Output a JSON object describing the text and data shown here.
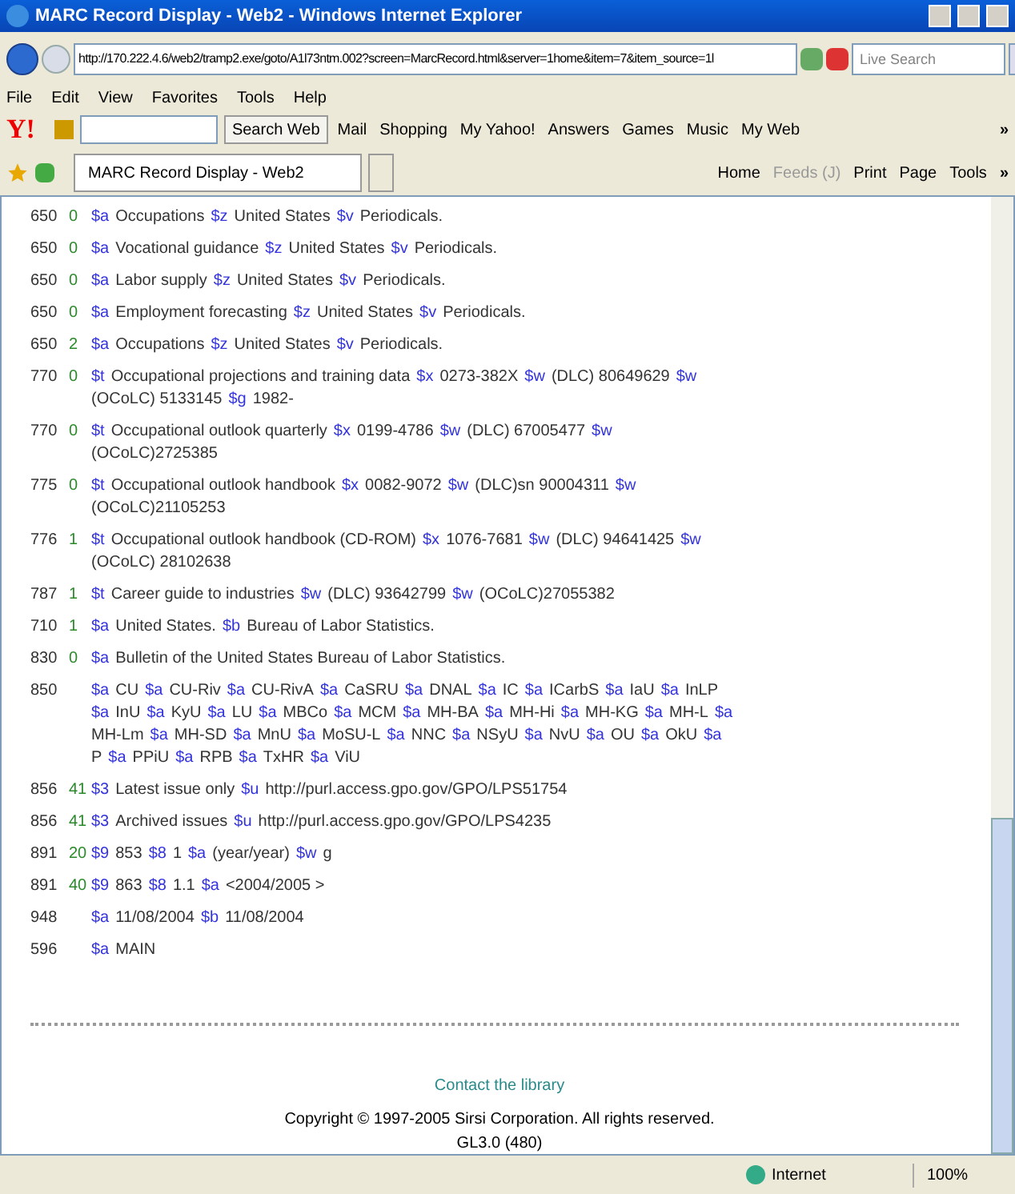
{
  "window": {
    "title": "MARC Record Display - Web2 - Windows Internet Explorer"
  },
  "address_bar": {
    "url": "http://170.222.4.6/web2/tramp2.exe/goto/A1l73ntm.002?screen=MarcRecord.html&server=1home&item=7&item_source=1l",
    "search_placeholder": "Live Search"
  },
  "menu": [
    "File",
    "Edit",
    "View",
    "Favorites",
    "Tools",
    "Help"
  ],
  "yahoo_toolbar": {
    "logo": "Y!",
    "search_button": "Search Web",
    "items": [
      "Mail",
      "Shopping",
      "My Yahoo!",
      "Answers",
      "Games",
      "Music",
      "My Web"
    ],
    "more": "»"
  },
  "tab": {
    "label": "MARC Record Display - Web2",
    "selected": true
  },
  "command_bar": [
    {
      "label": "Home",
      "disabled": false
    },
    {
      "label": "Feeds (J)",
      "disabled": true
    },
    {
      "label": "Print",
      "disabled": false
    },
    {
      "label": "Page",
      "disabled": false
    },
    {
      "label": "Tools",
      "disabled": false
    }
  ],
  "command_more": "»",
  "records": [
    {
      "tag": "650",
      "ind": "0",
      "subfields": [
        {
          "code": "$a",
          "text": "Occupations"
        },
        {
          "code": "$z",
          "text": "United States"
        },
        {
          "code": "$v",
          "text": "Periodicals."
        }
      ]
    },
    {
      "tag": "650",
      "ind": "0",
      "subfields": [
        {
          "code": "$a",
          "text": "Vocational guidance"
        },
        {
          "code": "$z",
          "text": "United States"
        },
        {
          "code": "$v",
          "text": "Periodicals."
        }
      ]
    },
    {
      "tag": "650",
      "ind": "0",
      "subfields": [
        {
          "code": "$a",
          "text": "Labor supply"
        },
        {
          "code": "$z",
          "text": "United States"
        },
        {
          "code": "$v",
          "text": "Periodicals."
        }
      ]
    },
    {
      "tag": "650",
      "ind": "0",
      "subfields": [
        {
          "code": "$a",
          "text": "Employment forecasting"
        },
        {
          "code": "$z",
          "text": "United States"
        },
        {
          "code": "$v",
          "text": "Periodicals."
        }
      ]
    },
    {
      "tag": "650",
      "ind": "2",
      "subfields": [
        {
          "code": "$a",
          "text": "Occupations"
        },
        {
          "code": "$z",
          "text": "United States"
        },
        {
          "code": "$v",
          "text": "Periodicals."
        }
      ]
    },
    {
      "tag": "770",
      "ind": "0",
      "subfields": [
        {
          "code": "$t",
          "text": "Occupational projections and training data"
        },
        {
          "code": "$x",
          "text": "0273-382X"
        },
        {
          "code": "$w",
          "text": "(DLC) 80649629"
        },
        {
          "code": "$w",
          "text": "(OCoLC) 5133145"
        },
        {
          "code": "$g",
          "text": "1982-"
        }
      ]
    },
    {
      "tag": "770",
      "ind": "0",
      "subfields": [
        {
          "code": "$t",
          "text": "Occupational outlook quarterly"
        },
        {
          "code": "$x",
          "text": "0199-4786"
        },
        {
          "code": "$w",
          "text": "(DLC) 67005477"
        },
        {
          "code": "$w",
          "text": "(OCoLC)2725385"
        }
      ]
    },
    {
      "tag": "775",
      "ind": "0",
      "subfields": [
        {
          "code": "$t",
          "text": "Occupational outlook handbook"
        },
        {
          "code": "$x",
          "text": "0082-9072"
        },
        {
          "code": "$w",
          "text": "(DLC)sn 90004311"
        },
        {
          "code": "$w",
          "text": "(OCoLC)21105253"
        }
      ]
    },
    {
      "tag": "776",
      "ind": "1",
      "subfields": [
        {
          "code": "$t",
          "text": "Occupational outlook handbook (CD-ROM)"
        },
        {
          "code": "$x",
          "text": "1076-7681"
        },
        {
          "code": "$w",
          "text": "(DLC) 94641425"
        },
        {
          "code": "$w",
          "text": "(OCoLC) 28102638"
        }
      ]
    },
    {
      "tag": "787",
      "ind": "1",
      "subfields": [
        {
          "code": "$t",
          "text": "Career guide to industries"
        },
        {
          "code": "$w",
          "text": "(DLC) 93642799"
        },
        {
          "code": "$w",
          "text": "(OCoLC)27055382"
        }
      ]
    },
    {
      "tag": "710",
      "ind": "1",
      "subfields": [
        {
          "code": "$a",
          "text": "United States."
        },
        {
          "code": "$b",
          "text": "Bureau of Labor Statistics."
        }
      ]
    },
    {
      "tag": "830",
      "ind": "0",
      "subfields": [
        {
          "code": "$a",
          "text": "Bulletin of the United States Bureau of Labor Statistics."
        }
      ]
    },
    {
      "tag": "850",
      "subfields": [
        {
          "code": "$a",
          "text": "CU"
        },
        {
          "code": "$a",
          "text": "CU-Riv"
        },
        {
          "code": "$a",
          "text": "CU-RivA"
        },
        {
          "code": "$a",
          "text": "CaSRU"
        },
        {
          "code": "$a",
          "text": "DNAL"
        },
        {
          "code": "$a",
          "text": "IC"
        },
        {
          "code": "$a",
          "text": "ICarbS"
        },
        {
          "code": "$a",
          "text": "IaU"
        },
        {
          "code": "$a",
          "text": "InLP"
        },
        {
          "code": "$a",
          "text": "InU"
        },
        {
          "code": "$a",
          "text": "KyU"
        },
        {
          "code": "$a",
          "text": "LU"
        },
        {
          "code": "$a",
          "text": "MBCo"
        },
        {
          "code": "$a",
          "text": "MCM"
        },
        {
          "code": "$a",
          "text": "MH-BA"
        },
        {
          "code": "$a",
          "text": "MH-Hi"
        },
        {
          "code": "$a",
          "text": "MH-KG"
        },
        {
          "code": "$a",
          "text": "MH-L"
        },
        {
          "code": "$a",
          "text": "MH-Lm"
        },
        {
          "code": "$a",
          "text": "MH-SD"
        },
        {
          "code": "$a",
          "text": "MnU"
        },
        {
          "code": "$a",
          "text": "MoSU-L"
        },
        {
          "code": "$a",
          "text": "NNC"
        },
        {
          "code": "$a",
          "text": "NSyU"
        },
        {
          "code": "$a",
          "text": "NvU"
        },
        {
          "code": "$a",
          "text": "OU"
        },
        {
          "code": "$a",
          "text": "OkU"
        },
        {
          "code": "$a",
          "text": "P"
        },
        {
          "code": "$a",
          "text": "PPiU"
        },
        {
          "code": "$a",
          "text": "RPB"
        },
        {
          "code": "$a",
          "text": "TxHR"
        },
        {
          "code": "$a",
          "text": "ViU"
        }
      ]
    },
    {
      "tag": "856",
      "ind": "41",
      "subfields": [
        {
          "code": "$3",
          "text": "Latest issue only"
        },
        {
          "code": "$u",
          "text": "http://purl.access.gpo.gov/GPO/LPS51754"
        }
      ]
    },
    {
      "tag": "856",
      "ind": "41",
      "subfields": [
        {
          "code": "$3",
          "text": "Archived issues"
        },
        {
          "code": "$u",
          "text": "http://purl.access.gpo.gov/GPO/LPS4235"
        }
      ]
    },
    {
      "tag": "891",
      "ind": "20",
      "subfields": [
        {
          "code": "$9",
          "text": "853"
        },
        {
          "code": "$8",
          "text": "1"
        },
        {
          "code": "$a",
          "text": "(year/year)"
        },
        {
          "code": "$w",
          "text": "g"
        }
      ]
    },
    {
      "tag": "891",
      "ind": "40",
      "subfields": [
        {
          "code": "$9",
          "text": "863"
        },
        {
          "code": "$8",
          "text": "1.1"
        },
        {
          "code": "$a",
          "text": "<2004/2005 >"
        }
      ]
    },
    {
      "tag": "948",
      "subfields": [
        {
          "code": "$a",
          "text": "11/08/2004"
        },
        {
          "code": "$b",
          "text": "11/08/2004"
        }
      ]
    },
    {
      "tag": "596",
      "subfields": [
        {
          "code": "$a",
          "text": "MAIN"
        }
      ]
    }
  ],
  "footer": {
    "link": "Contact the library",
    "copyright": "Copyright © 1997-2005 Sirsi Corporation. All rights reserved.",
    "version": "GL3.0 (480)"
  },
  "status_bar": {
    "zone": "Internet",
    "zoom": "100%"
  }
}
